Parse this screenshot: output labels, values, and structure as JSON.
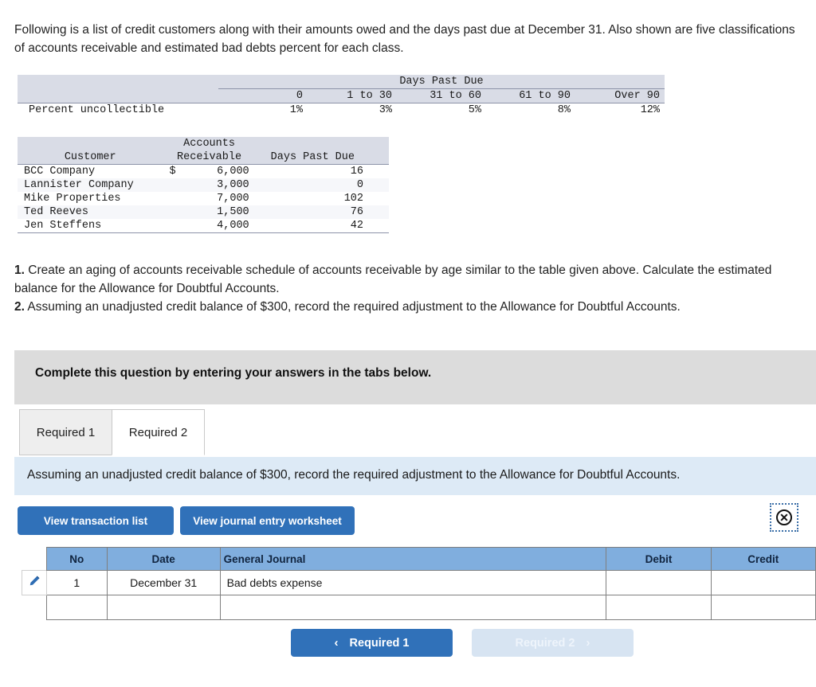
{
  "intro": "Following is a list of credit customers along with their amounts owed and the days past due at December 31. Also shown are five classifications of accounts receivable and estimated bad debts percent for each class.",
  "days_past_due_table": {
    "group_header": "Days Past Due",
    "row_label": "Percent uncollectible",
    "columns": [
      "0",
      "1 to 30",
      "31 to 60",
      "61 to 90",
      "Over 90"
    ],
    "percents": [
      "1%",
      "3%",
      "5%",
      "8%",
      "12%"
    ]
  },
  "customer_table": {
    "headers": {
      "customer": "Customer",
      "ar_line1": "Accounts",
      "ar_line2": "Receivable",
      "days": "Days Past Due"
    },
    "rows": [
      {
        "customer": "BCC Company",
        "currency": "$",
        "amount": "6,000",
        "days": "16"
      },
      {
        "customer": "Lannister Company",
        "currency": "",
        "amount": "3,000",
        "days": "0"
      },
      {
        "customer": "Mike Properties",
        "currency": "",
        "amount": "7,000",
        "days": "102"
      },
      {
        "customer": "Ted Reeves",
        "currency": "",
        "amount": "1,500",
        "days": "76"
      },
      {
        "customer": "Jen Steffens",
        "currency": "",
        "amount": "4,000",
        "days": "42"
      }
    ]
  },
  "requirements": {
    "num1": "1.",
    "text1": " Create an aging of accounts receivable schedule of accounts receivable by age similar to the table given above. Calculate the estimated balance for the Allowance for Doubtful Accounts.",
    "num2": "2.",
    "text2": " Assuming an unadjusted credit balance of $300, record the required adjustment to the Allowance for Doubtful Accounts."
  },
  "banner": {
    "text": "Complete this question by entering your answers in the tabs below."
  },
  "tabs": [
    {
      "label": "Required 1",
      "active": false
    },
    {
      "label": "Required 2",
      "active": true
    }
  ],
  "infobar": {
    "text": "Assuming an unadjusted credit balance of $300, record the required adjustment to the Allowance for Doubtful Accounts."
  },
  "actions": {
    "view_transaction_list": "View transaction list",
    "view_journal_worksheet": "View journal entry worksheet",
    "close_icon": "circle-x-icon"
  },
  "journal": {
    "headers": [
      "No",
      "Date",
      "General Journal",
      "Debit",
      "Credit"
    ],
    "rows": [
      {
        "no": "1",
        "date": "December 31",
        "account": "Bad debts expense",
        "debit": "",
        "credit": "",
        "edit_icon": "pencil-icon"
      },
      {
        "no": "",
        "date": "",
        "account": "",
        "debit": "",
        "credit": "",
        "edit_icon": ""
      }
    ]
  },
  "footer_nav": {
    "prev_label": "Required 1",
    "prev_chevron": "‹",
    "next_label": "Required 2",
    "next_chevron": "›"
  },
  "colors": {
    "accent_blue": "#3071b9",
    "table_header_blue": "#80aede",
    "info_bar_blue": "#ddeaf6",
    "banner_gray": "#dcdcdc",
    "table_band_gray": "#d9dce6"
  }
}
